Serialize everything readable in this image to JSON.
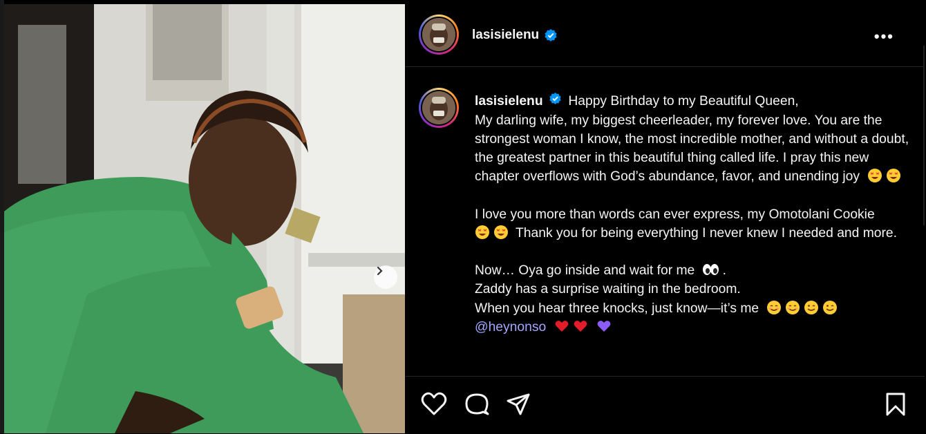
{
  "post": {
    "username": "lasisielenu",
    "verified": true
  },
  "caption": {
    "username": "lasisielenu",
    "lines": [
      "Happy Birthday to my Beautiful Queen,",
      "My darling wife, my biggest cheerleader, my forever love. You are the strongest woman I know, the most incredible mother, and without a doubt, the greatest partner in this beautiful thing called life. I pray this new chapter overflows with God’s abundance, favor, and unending joy",
      "I love you more than words can ever express, my Omotolani Cookie",
      "Thank you for being everything I never knew I needed and more.",
      "Now… Oya go inside and wait for me",
      "Zaddy has a surprise waiting in the bedroom.",
      "When you hear three knocks, just know—it’s me",
      "@heynonso"
    ]
  },
  "icons": {
    "more": "more-options-icon",
    "like": "heart-icon",
    "comment": "comment-icon",
    "share": "share-icon",
    "save": "bookmark-icon",
    "next": "chevron-right-icon",
    "verified": "verified-badge-icon"
  },
  "colors": {
    "background": "#000000",
    "mention": "#a5a7ff",
    "verified": "#0095f6",
    "heart_red": "#e11d2a",
    "heart_purple": "#8b5cf6"
  }
}
